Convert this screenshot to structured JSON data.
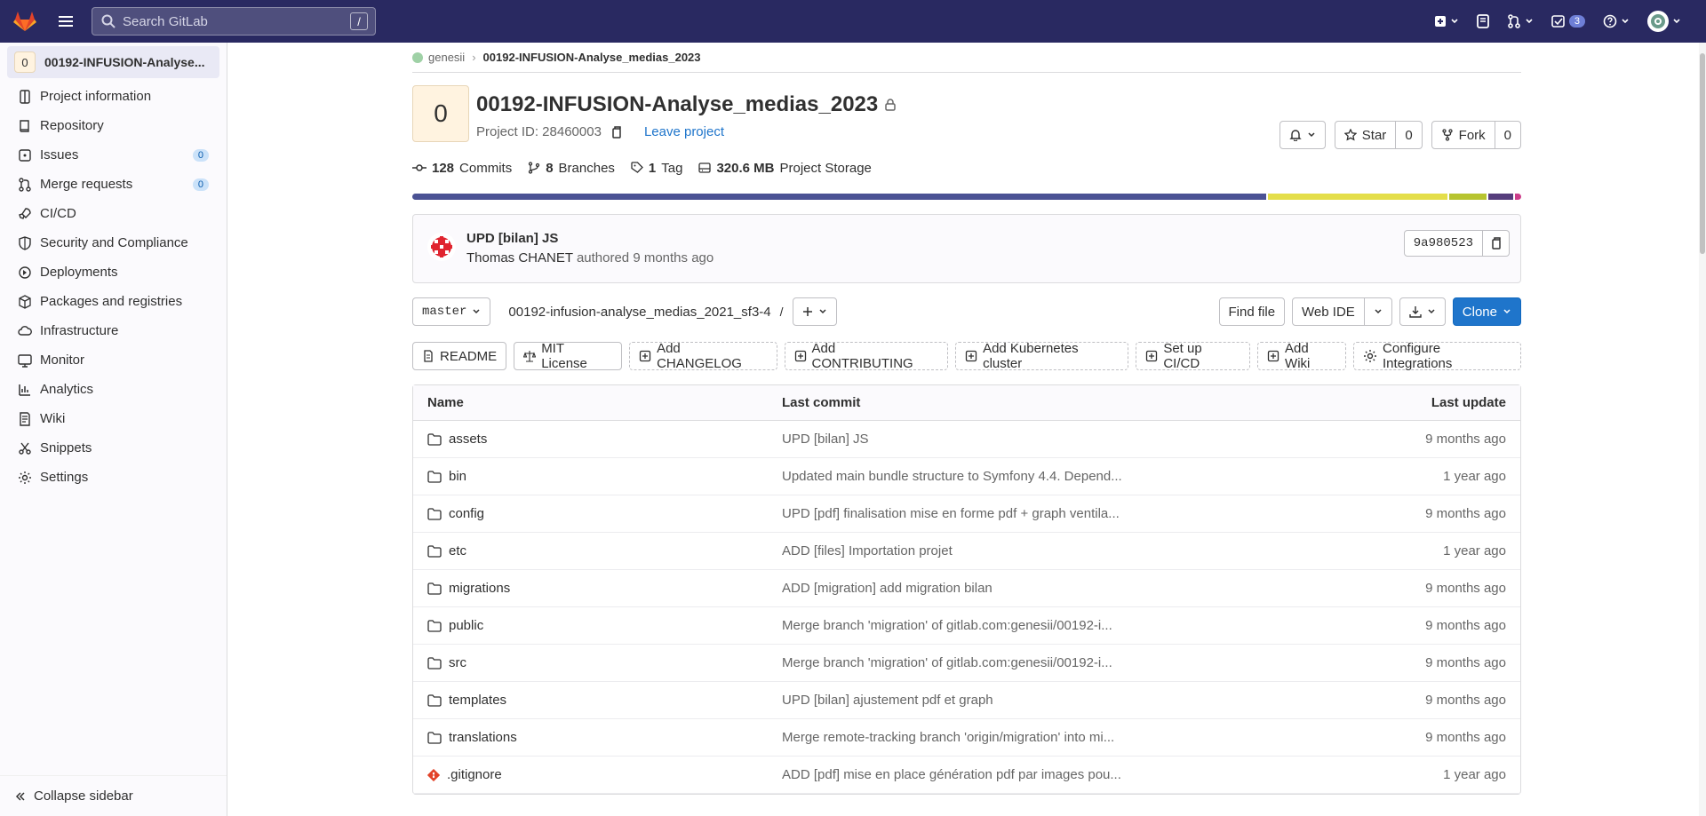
{
  "topbar": {
    "search_placeholder": "Search GitLab",
    "search_shortcut": "/",
    "todo_count": "3"
  },
  "sidebar": {
    "project_avatar_letter": "0",
    "project_name": "00192-INFUSION-Analyse...",
    "items": [
      {
        "label": "Project information",
        "icon": "info-icon"
      },
      {
        "label": "Repository",
        "icon": "book-icon"
      },
      {
        "label": "Issues",
        "icon": "issues-icon",
        "count": "0"
      },
      {
        "label": "Merge requests",
        "icon": "merge-request-icon",
        "count": "0"
      },
      {
        "label": "CI/CD",
        "icon": "rocket-icon"
      },
      {
        "label": "Security and Compliance",
        "icon": "shield-icon"
      },
      {
        "label": "Deployments",
        "icon": "deployments-icon"
      },
      {
        "label": "Packages and registries",
        "icon": "package-icon"
      },
      {
        "label": "Infrastructure",
        "icon": "cloud-icon"
      },
      {
        "label": "Monitor",
        "icon": "monitor-icon"
      },
      {
        "label": "Analytics",
        "icon": "chart-icon"
      },
      {
        "label": "Wiki",
        "icon": "wiki-icon"
      },
      {
        "label": "Snippets",
        "icon": "snippet-icon"
      },
      {
        "label": "Settings",
        "icon": "gear-icon"
      }
    ],
    "collapse_label": "Collapse sidebar"
  },
  "breadcrumb": {
    "namespace": "genesii",
    "project": "00192-INFUSION-Analyse_medias_2023"
  },
  "project": {
    "avatar_letter": "0",
    "title": "00192-INFUSION-Analyse_medias_2023",
    "id_label": "Project ID: 28460003",
    "leave_label": "Leave project",
    "star_label": "Star",
    "star_count": "0",
    "fork_label": "Fork",
    "fork_count": "0"
  },
  "stats": {
    "commits_count": "128",
    "commits_label": "Commits",
    "branches_count": "8",
    "branches_label": "Branches",
    "tags_count": "1",
    "tags_label": "Tag",
    "storage_size": "320.6 MB",
    "storage_label": "Project Storage"
  },
  "languages": [
    {
      "share": 77.5,
      "color": "#4b5294"
    },
    {
      "share": 16.3,
      "color": "#e4de4a"
    },
    {
      "share": 3.4,
      "color": "#b7c42f"
    },
    {
      "share": 2.2,
      "color": "#563d7c"
    },
    {
      "share": 0.6,
      "color": "#cc3d8a"
    }
  ],
  "last_commit": {
    "title": "UPD [bilan] JS",
    "author": "Thomas CHANET",
    "authored_label": "authored 9 months ago",
    "sha": "9a980523"
  },
  "toolbar": {
    "branch": "master",
    "path": "00192-infusion-analyse_medias_2021_sf3-4",
    "path_sep": "/",
    "find_file": "Find file",
    "web_ide": "Web IDE",
    "clone": "Clone"
  },
  "shortcuts": [
    {
      "label": "README",
      "icon": "doc-icon",
      "dashed": false
    },
    {
      "label": "MIT License",
      "icon": "scale-icon",
      "dashed": false
    },
    {
      "label": "Add CHANGELOG",
      "icon": "plus-square-icon",
      "dashed": true
    },
    {
      "label": "Add CONTRIBUTING",
      "icon": "plus-square-icon",
      "dashed": true
    },
    {
      "label": "Add Kubernetes cluster",
      "icon": "plus-square-icon",
      "dashed": true
    },
    {
      "label": "Set up CI/CD",
      "icon": "plus-square-icon",
      "dashed": true
    },
    {
      "label": "Add Wiki",
      "icon": "plus-square-icon",
      "dashed": true
    },
    {
      "label": "Configure Integrations",
      "icon": "gear-icon",
      "dashed": true
    }
  ],
  "files_table": {
    "headers": {
      "name": "Name",
      "commit": "Last commit",
      "update": "Last update"
    },
    "rows": [
      {
        "name": "assets",
        "type": "folder",
        "commit": "UPD [bilan] JS",
        "date": "9 months ago"
      },
      {
        "name": "bin",
        "type": "folder",
        "commit": "Updated main bundle structure to Symfony 4.4. Depend...",
        "date": "1 year ago"
      },
      {
        "name": "config",
        "type": "folder",
        "commit": "UPD [pdf] finalisation mise en forme pdf + graph ventila...",
        "date": "9 months ago"
      },
      {
        "name": "etc",
        "type": "folder",
        "commit": "ADD [files] Importation projet",
        "date": "1 year ago"
      },
      {
        "name": "migrations",
        "type": "folder",
        "commit": "ADD [migration] add migration bilan",
        "date": "9 months ago"
      },
      {
        "name": "public",
        "type": "folder",
        "commit": "Merge branch 'migration' of gitlab.com:genesii/00192-i...",
        "date": "9 months ago"
      },
      {
        "name": "src",
        "type": "folder",
        "commit": "Merge branch 'migration' of gitlab.com:genesii/00192-i...",
        "date": "9 months ago"
      },
      {
        "name": "templates",
        "type": "folder",
        "commit": "UPD [bilan] ajustement pdf et graph",
        "date": "9 months ago"
      },
      {
        "name": "translations",
        "type": "folder",
        "commit": "Merge remote-tracking branch 'origin/migration' into mi...",
        "date": "9 months ago"
      },
      {
        "name": ".gitignore",
        "type": "git",
        "commit": "ADD [pdf] mise en place génération pdf par images pou...",
        "date": "1 year ago"
      }
    ]
  }
}
